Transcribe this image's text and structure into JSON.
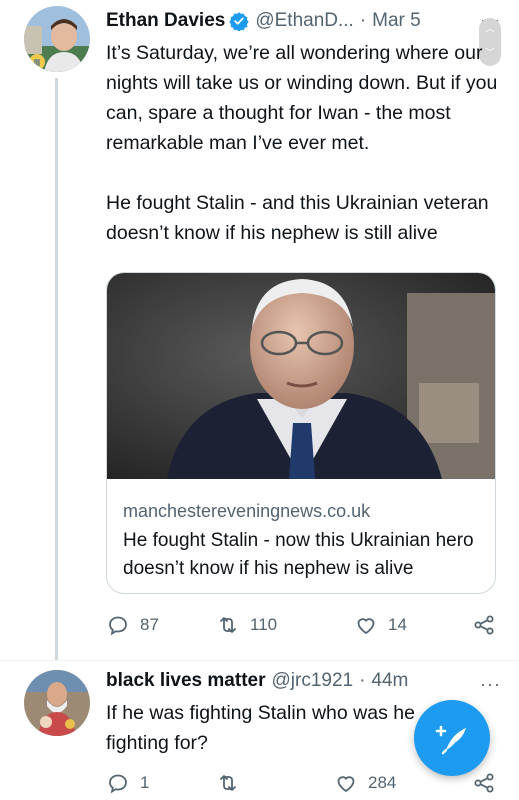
{
  "tweet1": {
    "name": "Ethan Davies",
    "handle": "@EthanD...",
    "dot": "·",
    "date": "Mar 5",
    "more": "···",
    "text": "It’s Saturday, we’re all wondering where our nights will take us or winding down. But if you can, spare a thought for Iwan - the most remarkable man I’ve ever met.\n\nHe fought Stalin - and this Ukrainian veteran doesn’t know if his nephew is still alive",
    "card": {
      "domain": "manchestereveningnews.co.uk",
      "title": "He fought Stalin - now this Ukrainian hero doesn’t know if his nephew is alive"
    },
    "replies": "87",
    "retweets": "110",
    "likes": "14"
  },
  "tweet2": {
    "name": "black lives matter",
    "handle": "@jrc1921",
    "dot": "·",
    "date": "44m",
    "more": "···",
    "text": "If he was fighting Stalin who was he fighting for?",
    "replies": "1",
    "retweets": "",
    "likes": "284"
  },
  "colors": {
    "accent": "#1d9bf0",
    "secondary_text": "#536471",
    "border": "#cfd9de"
  },
  "icons": [
    "verified-badge-icon",
    "reply-icon",
    "retweet-icon",
    "like-icon",
    "share-icon",
    "compose-tweet-icon",
    "more-icon"
  ]
}
